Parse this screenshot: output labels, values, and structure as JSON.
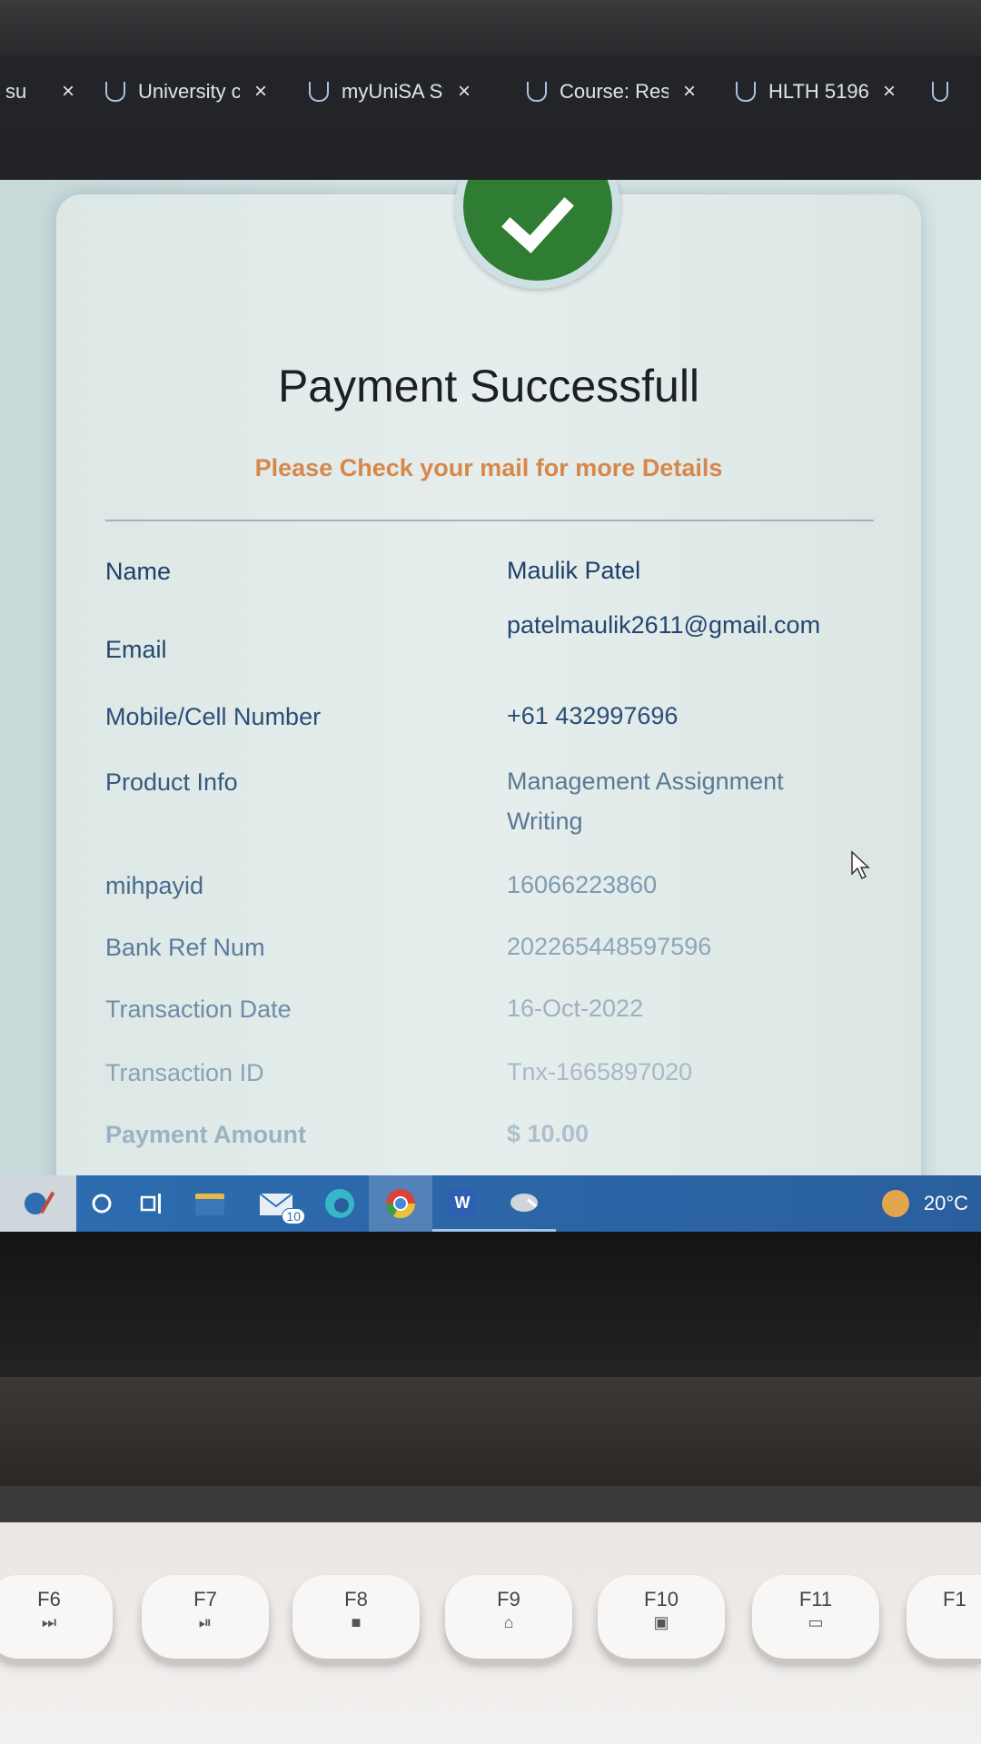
{
  "browser": {
    "tabs": [
      {
        "label": "su",
        "has_icon": false
      },
      {
        "label": "University c",
        "has_icon": true
      },
      {
        "label": "myUniSA St",
        "has_icon": true
      },
      {
        "label": "Course: Res",
        "has_icon": true
      },
      {
        "label": "HLTH 5196",
        "has_icon": true
      }
    ],
    "close_glyph": "×",
    "tab_icon": "unisa-logo-icon"
  },
  "payment": {
    "title": "Payment Successfull",
    "subtitle": "Please Check your mail for more Details",
    "details": [
      {
        "label": "Name",
        "value": "Maulik Patel"
      },
      {
        "label": "Email",
        "value": "patelmaulik2611@gmail.com"
      },
      {
        "label": "Mobile/Cell Number",
        "value": "+61 432997696"
      },
      {
        "label": "Product Info",
        "value": "Management Assignment Writing"
      },
      {
        "label": "mihpayid",
        "value": "16066223860"
      },
      {
        "label": "Bank Ref Num",
        "value": "202265448597596"
      },
      {
        "label": "Transaction Date",
        "value": "16-Oct-2022"
      },
      {
        "label": "Transaction ID",
        "value": "Tnx-1665897020"
      },
      {
        "label": "Payment Amount",
        "value": "$ 10.00"
      }
    ],
    "check_icon": "checkmark-icon"
  },
  "taskbar": {
    "mail_badge": "10",
    "word_letter": "W",
    "temperature": "20°C",
    "icons": [
      "weather-widget-icon",
      "search-icon",
      "task-view-icon",
      "file-explorer-icon",
      "mail-icon",
      "edge-icon",
      "chrome-icon",
      "word-icon",
      "app-icon"
    ]
  },
  "keyboard": {
    "keys": [
      {
        "label": "F6",
        "sub": "⏭"
      },
      {
        "label": "F7",
        "sub": "⏯"
      },
      {
        "label": "F8",
        "sub": "■"
      },
      {
        "label": "F9",
        "sub": "⌂"
      },
      {
        "label": "F10",
        "sub": "▣"
      },
      {
        "label": "F11",
        "sub": "▭"
      },
      {
        "label": "F1",
        "sub": ""
      }
    ]
  },
  "colors": {
    "success_green": "#2f7d32",
    "subtitle_orange": "#d8874a",
    "label_blue": "#1f3f6a",
    "taskbar_blue": "#2d6db0"
  }
}
